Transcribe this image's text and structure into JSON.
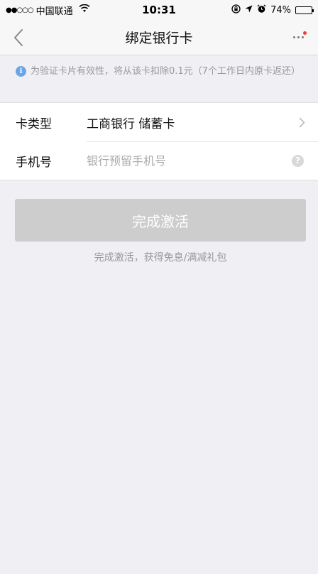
{
  "status_bar": {
    "signal": "●●○○○",
    "carrier": "中国联通",
    "time": "10:31",
    "battery": "74%"
  },
  "nav": {
    "title": "绑定银行卡"
  },
  "notice": {
    "text": "为验证卡片有效性，将从该卡扣除0.1元（7个工作日内原卡返还）"
  },
  "form": {
    "card_type_label": "卡类型",
    "card_type_value": "工商银行 储蓄卡",
    "phone_label": "手机号",
    "phone_placeholder": "银行预留手机号",
    "phone_value": ""
  },
  "action": {
    "button_label": "完成激活",
    "promo_text": "完成激活，获得免息/满减礼包"
  },
  "colors": {
    "background": "#efeff4",
    "button_disabled": "#cdcdcd",
    "info_icon": "#6aa6e6",
    "badge": "#f23c3c"
  }
}
